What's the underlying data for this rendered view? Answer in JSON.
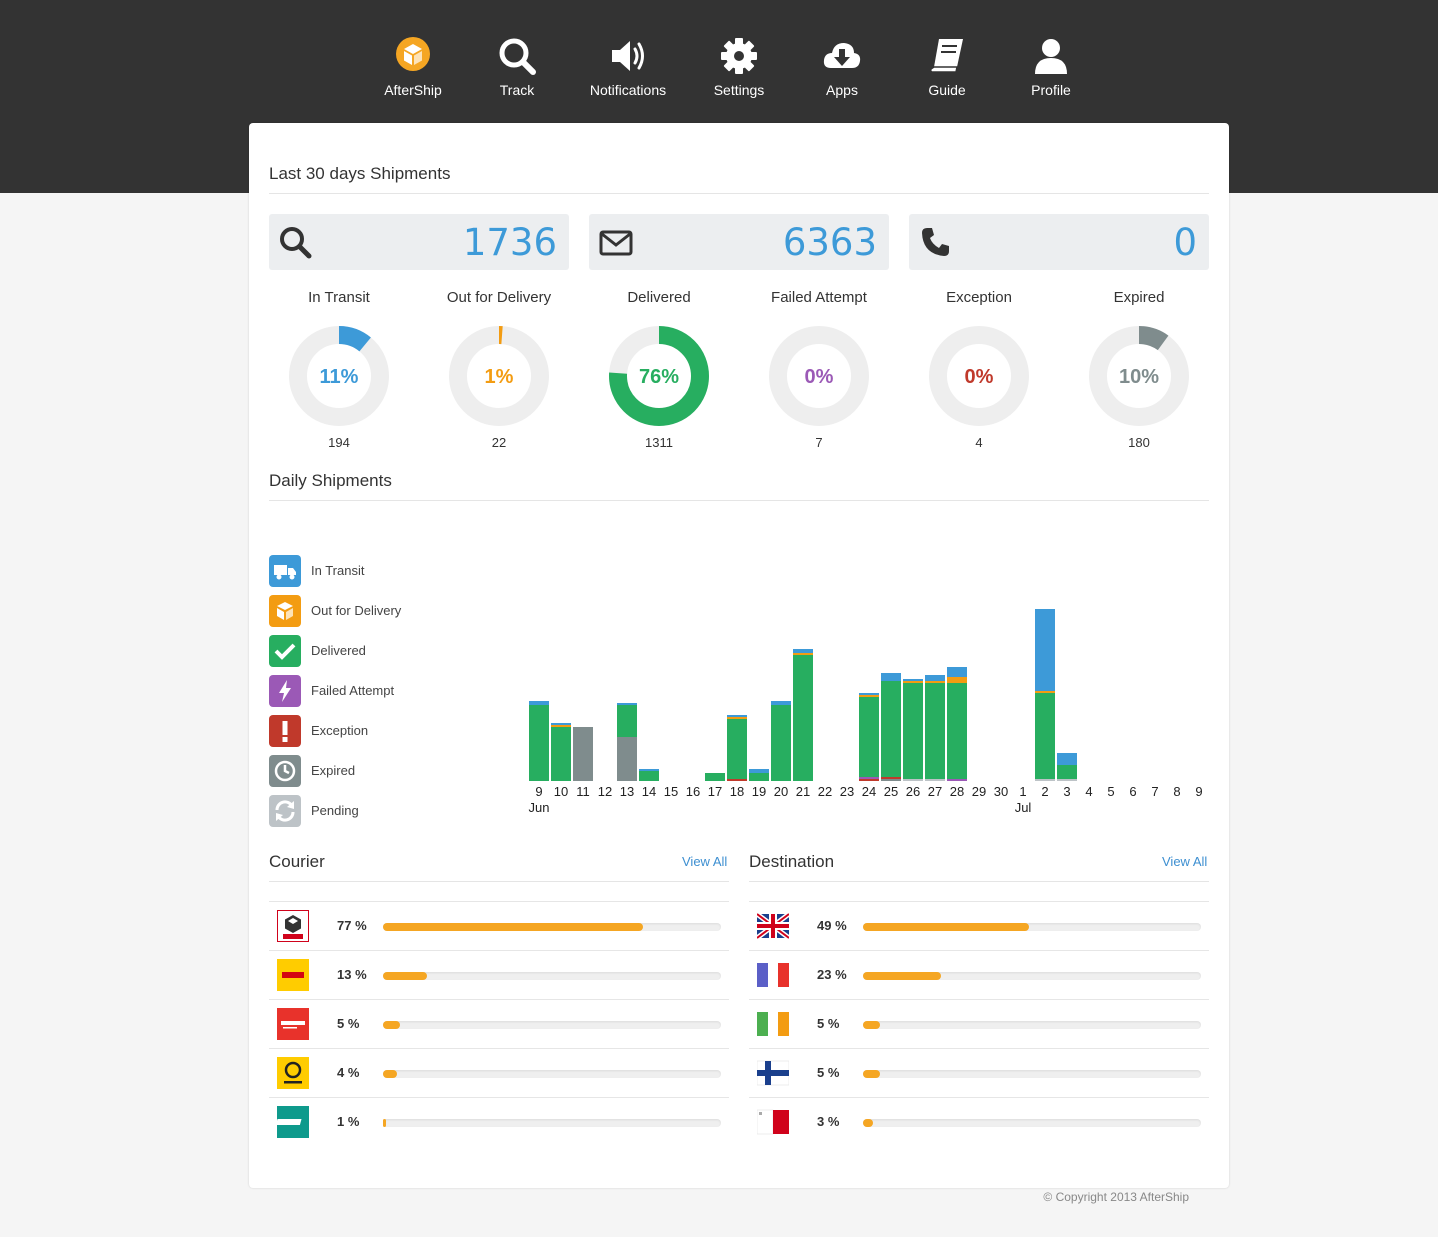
{
  "nav": [
    {
      "label": "AfterShip",
      "icon": "aftership-logo-icon"
    },
    {
      "label": "Track",
      "icon": "search-icon"
    },
    {
      "label": "Notifications",
      "icon": "speaker-icon"
    },
    {
      "label": "Settings",
      "icon": "gear-icon"
    },
    {
      "label": "Apps",
      "icon": "cloud-download-icon"
    },
    {
      "label": "Guide",
      "icon": "book-icon"
    },
    {
      "label": "Profile",
      "icon": "user-icon"
    }
  ],
  "summary": {
    "title": "Last 30 days Shipments",
    "stats": [
      {
        "icon": "search-icon",
        "value": "1736"
      },
      {
        "icon": "envelope-icon",
        "value": "6363"
      },
      {
        "icon": "phone-icon",
        "value": "0"
      }
    ],
    "donuts": [
      {
        "label": "In Transit",
        "percent": "11%",
        "fraction": 0.11,
        "count": "194",
        "color": "#3d9ad8"
      },
      {
        "label": "Out for Delivery",
        "percent": "1%",
        "fraction": 0.012,
        "count": "22",
        "color": "#f39c12"
      },
      {
        "label": "Delivered",
        "percent": "76%",
        "fraction": 0.76,
        "count": "1311",
        "color": "#27ae60"
      },
      {
        "label": "Failed Attempt",
        "percent": "0%",
        "fraction": 0,
        "count": "7",
        "color": "#9b59b6"
      },
      {
        "label": "Exception",
        "percent": "0%",
        "fraction": 0,
        "count": "4",
        "color": "#c0392b"
      },
      {
        "label": "Expired",
        "percent": "10%",
        "fraction": 0.1,
        "count": "180",
        "color": "#7f8c8d"
      }
    ]
  },
  "daily": {
    "title": "Daily Shipments",
    "legend": [
      {
        "label": "In Transit",
        "icon": "truck-icon",
        "color": "#3d9ad8"
      },
      {
        "label": "Out for Delivery",
        "icon": "box-icon",
        "color": "#f39c12"
      },
      {
        "label": "Delivered",
        "icon": "check-icon",
        "color": "#27ae60"
      },
      {
        "label": "Failed Attempt",
        "icon": "bolt-icon",
        "color": "#9b59b6"
      },
      {
        "label": "Exception",
        "icon": "exclamation-icon",
        "color": "#c0392b"
      },
      {
        "label": "Expired",
        "icon": "clock-icon",
        "color": "#7f8c8d"
      },
      {
        "label": "Pending",
        "icon": "refresh-icon",
        "color": "#bdc3c7"
      }
    ]
  },
  "chart_data": {
    "type": "bar",
    "stacked": true,
    "categories": [
      "9",
      "10",
      "11",
      "12",
      "13",
      "14",
      "15",
      "16",
      "17",
      "18",
      "19",
      "20",
      "21",
      "22",
      "23",
      "24",
      "25",
      "26",
      "27",
      "28",
      "29",
      "30",
      "1",
      "2",
      "3",
      "4",
      "5",
      "6",
      "7",
      "8",
      "9"
    ],
    "month_labels": [
      {
        "index": 0,
        "label": "Jun"
      },
      {
        "index": 22,
        "label": "Jul"
      }
    ],
    "series": [
      {
        "name": "Pending",
        "color": "#bdc3c7",
        "values": [
          0,
          0,
          0,
          0,
          0,
          0,
          0,
          0,
          0,
          0,
          0,
          0,
          0,
          0,
          0,
          0,
          0,
          1,
          1,
          0,
          0,
          0,
          0,
          1,
          1,
          0,
          0,
          0,
          0,
          0,
          0
        ]
      },
      {
        "name": "Expired",
        "color": "#7f8c8d",
        "values": [
          0,
          0,
          27,
          0,
          22,
          0,
          0,
          0,
          0,
          0,
          0,
          0,
          0,
          0,
          0,
          0,
          1,
          0,
          0,
          0,
          0,
          0,
          0,
          0,
          0,
          0,
          0,
          0,
          0,
          0,
          0
        ]
      },
      {
        "name": "Exception",
        "color": "#c0392b",
        "values": [
          0,
          0,
          0,
          0,
          0,
          0,
          0,
          0,
          0,
          1,
          0,
          0,
          0,
          0,
          0,
          1,
          1,
          0,
          0,
          0,
          0,
          0,
          0,
          0,
          0,
          0,
          0,
          0,
          0,
          0,
          0
        ]
      },
      {
        "name": "Failed Attempt",
        "color": "#9b59b6",
        "values": [
          0,
          0,
          0,
          0,
          0,
          0,
          0,
          0,
          0,
          0,
          0,
          0,
          0,
          0,
          0,
          1,
          0,
          0,
          0,
          1,
          0,
          0,
          0,
          0,
          0,
          0,
          0,
          0,
          0,
          0,
          0
        ]
      },
      {
        "name": "Delivered",
        "color": "#27ae60",
        "values": [
          38,
          27,
          0,
          0,
          16,
          5,
          0,
          0,
          4,
          30,
          4,
          38,
          63,
          0,
          0,
          40,
          48,
          48,
          48,
          48,
          0,
          0,
          0,
          43,
          7,
          0,
          0,
          0,
          0,
          0,
          0
        ]
      },
      {
        "name": "Out for Delivery",
        "color": "#f39c12",
        "values": [
          0,
          1,
          0,
          0,
          0,
          0,
          0,
          0,
          0,
          1,
          0,
          0,
          1,
          0,
          0,
          1,
          0,
          1,
          1,
          3,
          0,
          0,
          0,
          1,
          0,
          0,
          0,
          0,
          0,
          0,
          0
        ]
      },
      {
        "name": "In Transit",
        "color": "#3d9ad8",
        "values": [
          2,
          1,
          0,
          0,
          1,
          1,
          0,
          0,
          0,
          1,
          2,
          2,
          2,
          0,
          0,
          1,
          4,
          1,
          3,
          5,
          0,
          0,
          0,
          41,
          6,
          0,
          0,
          0,
          0,
          0,
          0
        ]
      }
    ]
  },
  "courier": {
    "title": "Courier",
    "view_all": "View All",
    "items": [
      {
        "logo": "dpd-logo-icon",
        "percent": "77 %",
        "fraction": 0.77
      },
      {
        "logo": "dhl-logo-icon",
        "percent": "13 %",
        "fraction": 0.13
      },
      {
        "logo": "aramex-logo-icon",
        "percent": "5 %",
        "fraction": 0.05
      },
      {
        "logo": "deutsche-post-logo-icon",
        "percent": "4 %",
        "fraction": 0.04
      },
      {
        "logo": "toll-logo-icon",
        "percent": "1 %",
        "fraction": 0.01
      }
    ]
  },
  "destination": {
    "title": "Destination",
    "view_all": "View All",
    "items": [
      {
        "flag": "uk-flag-icon",
        "percent": "49 %",
        "fraction": 0.49
      },
      {
        "flag": "france-flag-icon",
        "percent": "23 %",
        "fraction": 0.23
      },
      {
        "flag": "ireland-flag-icon",
        "percent": "5 %",
        "fraction": 0.05
      },
      {
        "flag": "finland-flag-icon",
        "percent": "5 %",
        "fraction": 0.05
      },
      {
        "flag": "malta-flag-icon",
        "percent": "3 %",
        "fraction": 0.03
      }
    ]
  },
  "footer": {
    "copyright": "© Copyright 2013 AfterShip"
  }
}
